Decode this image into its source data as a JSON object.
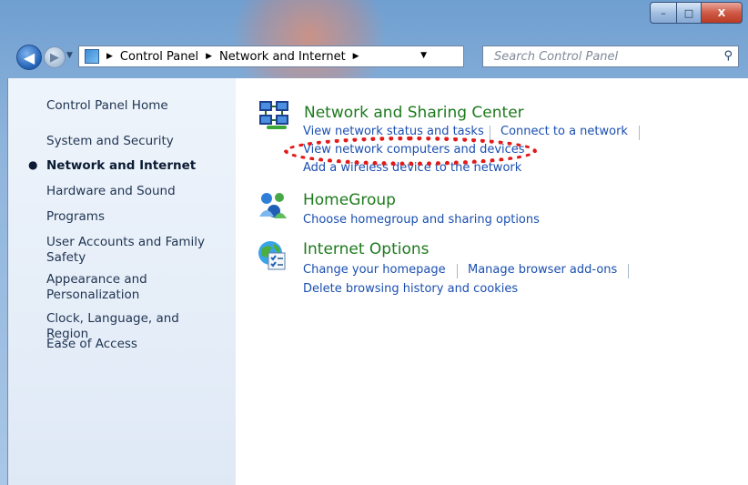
{
  "window": {
    "controls": {
      "minimize": "–",
      "maximize": "□",
      "close": "X"
    }
  },
  "navigation": {
    "back_icon": "back-arrow-icon",
    "forward_icon": "forward-arrow-icon",
    "breadcrumb": [
      "Control Panel",
      "Network and Internet"
    ],
    "search_placeholder": "Search Control Panel"
  },
  "sidebar": {
    "items": [
      {
        "label": "Control Panel Home"
      },
      {
        "label": "System and Security"
      },
      {
        "label": "Network and Internet",
        "active": true
      },
      {
        "label": "Hardware and Sound"
      },
      {
        "label": "Programs"
      },
      {
        "label": "User Accounts and Family Safety"
      },
      {
        "label": "Appearance and Personalization"
      },
      {
        "label": "Clock, Language, and Region"
      },
      {
        "label": "Ease of Access"
      }
    ]
  },
  "categories": [
    {
      "title": "Network and Sharing Center",
      "icon": "network-sharing-icon",
      "links": [
        "View network status and tasks",
        "Connect to a network",
        "View network computers and devices",
        "Add a wireless device to the network"
      ]
    },
    {
      "title": "HomeGroup",
      "icon": "homegroup-icon",
      "links": [
        "Choose homegroup and sharing options"
      ]
    },
    {
      "title": "Internet Options",
      "icon": "internet-options-icon",
      "links": [
        "Change your homepage",
        "Manage browser add-ons",
        "Delete browsing history and cookies"
      ]
    }
  ],
  "annotation": {
    "color": "#e21a1a"
  }
}
